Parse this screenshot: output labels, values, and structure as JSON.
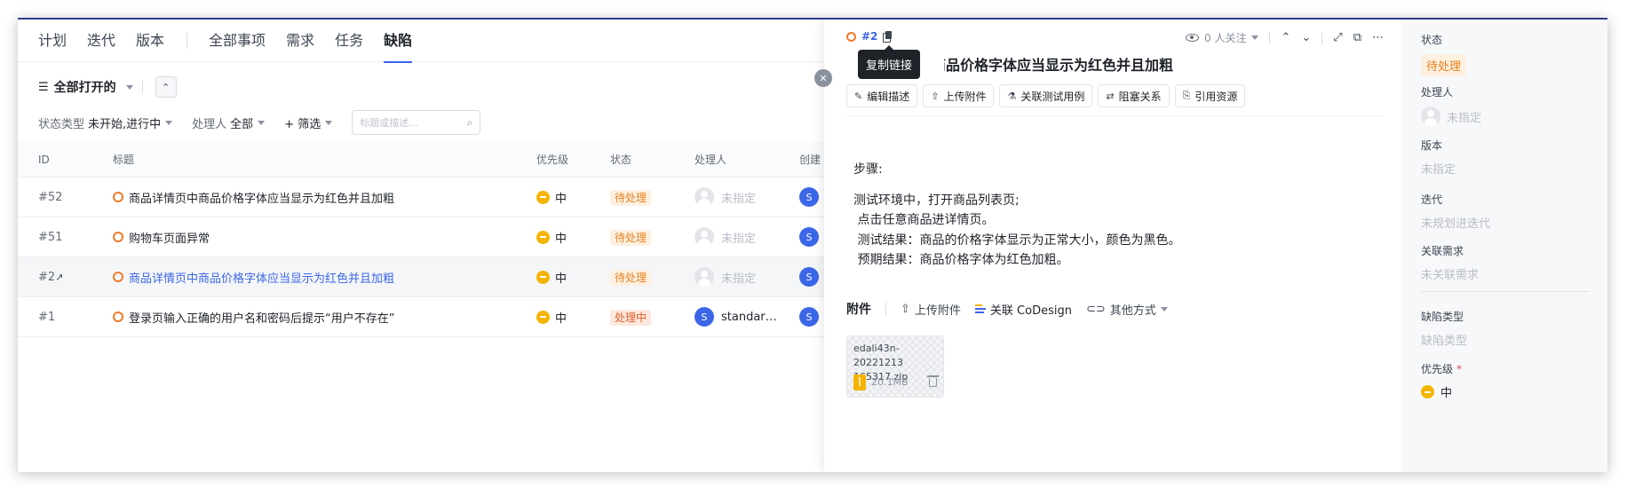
{
  "tabs": [
    {
      "label": "计划"
    },
    {
      "label": "迭代"
    },
    {
      "label": "版本"
    },
    {
      "label": "全部事项"
    },
    {
      "label": "需求"
    },
    {
      "label": "任务"
    },
    {
      "label": "缺陷"
    }
  ],
  "active_tab": "缺陷",
  "view": {
    "title": "全部打开的"
  },
  "filters": {
    "status_type_label": "状态类型",
    "status_type_value": "未开始,进行中",
    "assignee_label": "处理人",
    "assignee_value": "全部",
    "more_filter": "+ 筛选",
    "search_placeholder": "标题或描述..."
  },
  "table": {
    "headers": [
      "ID",
      "标题",
      "优先级",
      "状态",
      "处理人",
      "创建"
    ],
    "rows": [
      {
        "id": "#52",
        "title": "商品详情页中商品价格字体应当显示为红色并且加粗",
        "priority": "中",
        "status": "待处理",
        "assignee": "未指定",
        "creator_avatar": "S"
      },
      {
        "id": "#51",
        "title": "购物车页面异常",
        "priority": "中",
        "status": "待处理",
        "assignee": "未指定",
        "creator_avatar": "S"
      },
      {
        "id": "#2",
        "title": "商品详情页中商品价格字体应当显示为红色并且加粗",
        "priority": "中",
        "status": "待处理",
        "assignee": "未指定",
        "creator_avatar": "S"
      },
      {
        "id": "#1",
        "title": "登录页输入正确的用户名和密码后提示“用户不存在”",
        "priority": "中",
        "status": "处理中",
        "assignee": "standar…",
        "assignee_avatar": "S",
        "creator_avatar": "S"
      }
    ]
  },
  "detail": {
    "id": "#2",
    "tooltip": "复制链接",
    "title": "商品详情页中商品价格字体应当显示为红色并且加粗",
    "watchers": "0 人关注",
    "actions": [
      "编辑描述",
      "上传附件",
      "关联测试用例",
      "阻塞关系",
      "引用资源"
    ],
    "content": {
      "steps_label": "步骤:",
      "lines": [
        "测试环境中，打开商品列表页;",
        " 点击任意商品进详情页。",
        " 测试结果：商品的价格字体显示为正常大小，颜色为黑色。",
        " 预期结果：商品价格字体为红色加粗。"
      ]
    },
    "attachments": {
      "title": "附件",
      "upload": "上传附件",
      "codesign": "关联 CoDesign",
      "other": "其他方式",
      "file_name_line1": "edali43n-20221213",
      "file_name_line2": "165317.zip",
      "file_size": "20.1MB"
    }
  },
  "sidebar": {
    "status_label": "状态",
    "status_value": "待处理",
    "assignee_label": "处理人",
    "assignee_value": "未指定",
    "version_label": "版本",
    "version_value": "未指定",
    "iteration_label": "迭代",
    "iteration_value": "未规划进迭代",
    "related_label": "关联需求",
    "related_value": "未关联需求",
    "bug_type_label": "缺陷类型",
    "bug_type_value": "缺陷类型",
    "priority_label": "优先级",
    "priority_required": "*",
    "priority_value": "中"
  },
  "colors": {
    "accent": "#3b66e8",
    "bug": "#f07a2b",
    "priority_mid": "#f5b400",
    "status_todo": "#e8801e"
  }
}
